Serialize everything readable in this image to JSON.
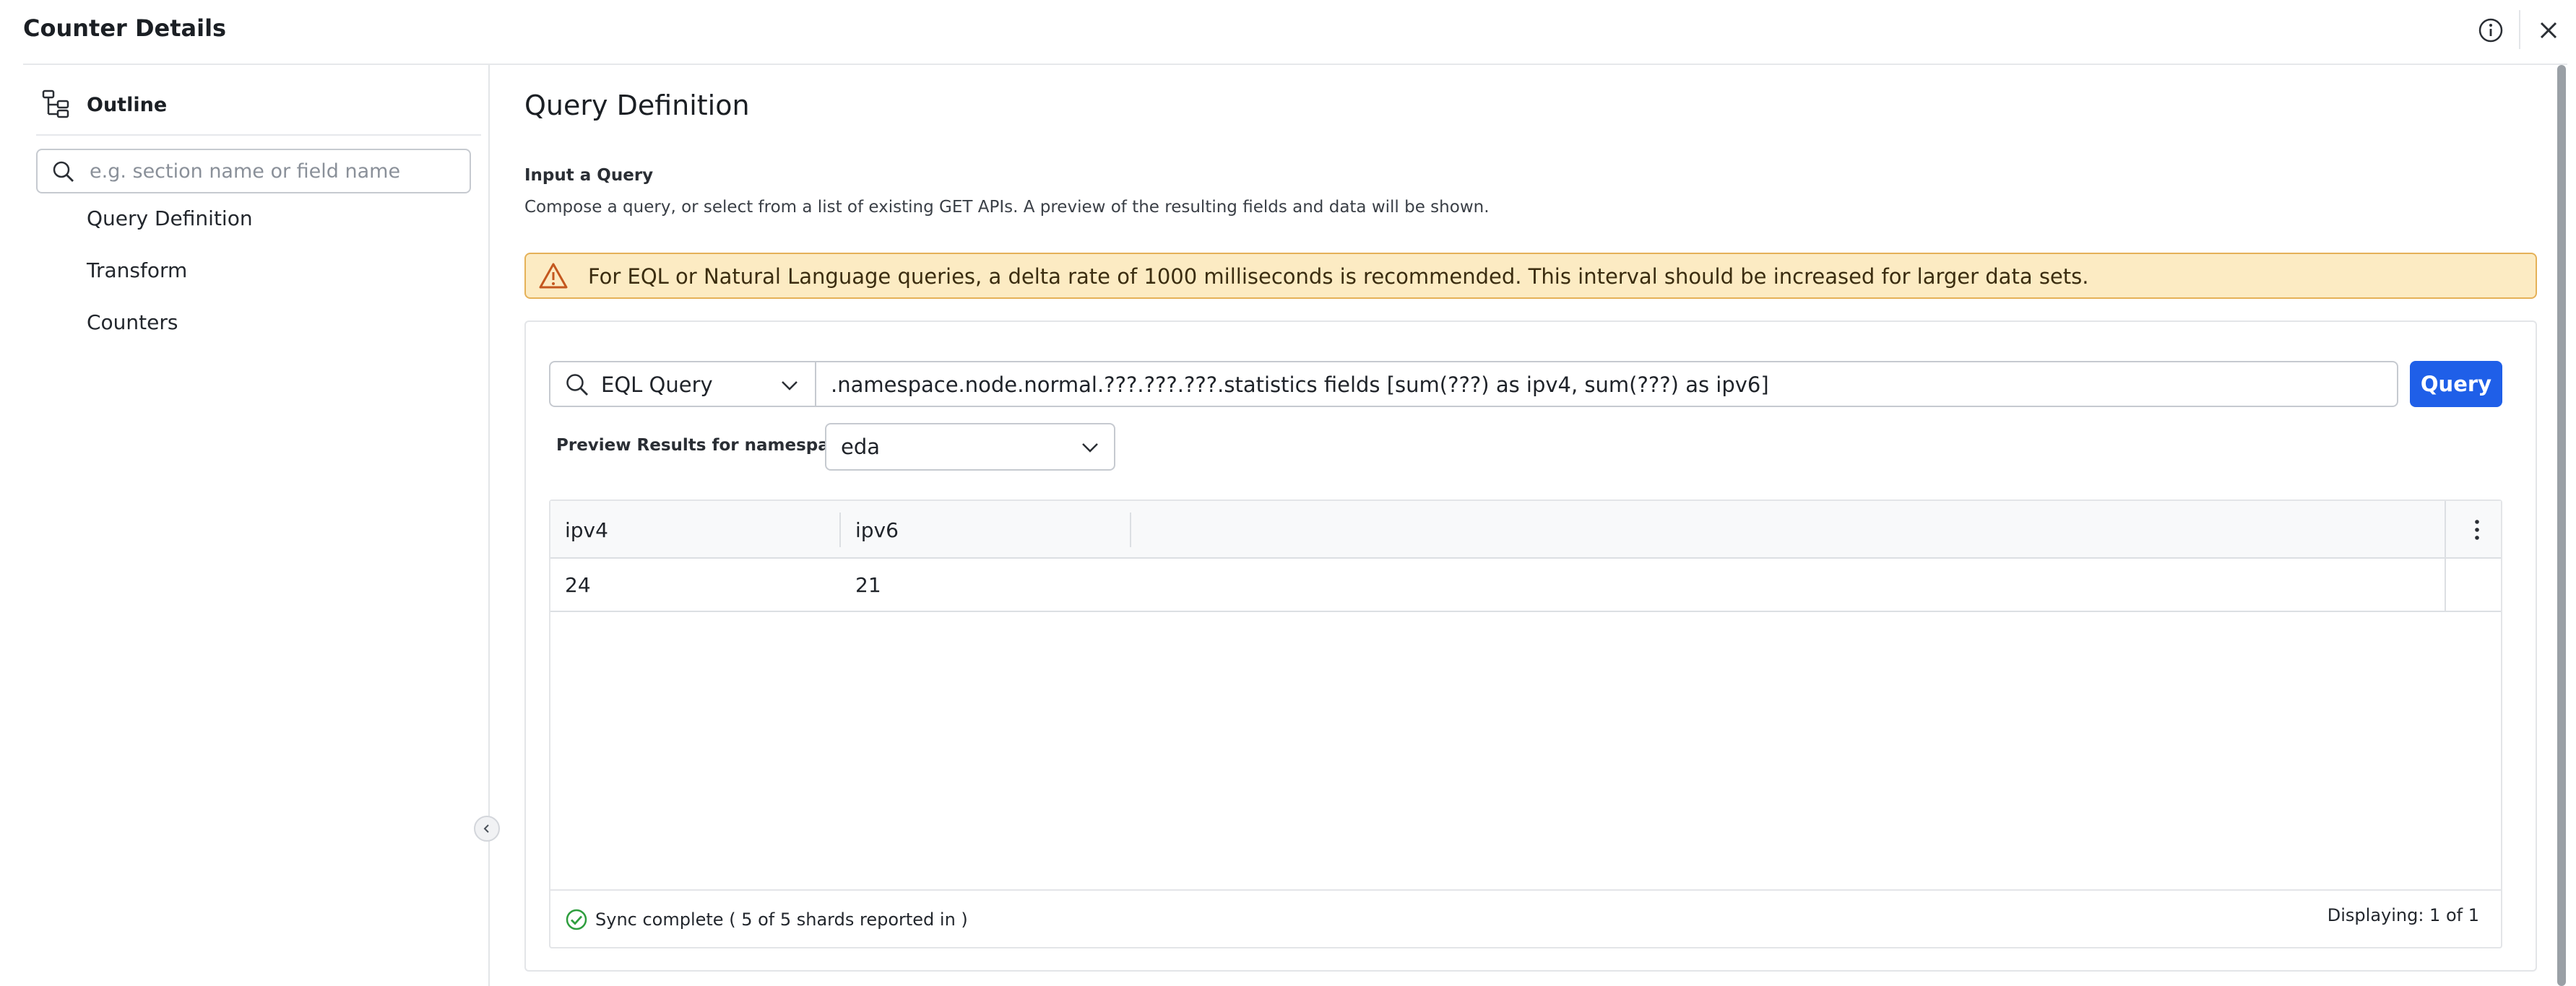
{
  "header": {
    "title": "Counter Details",
    "icons": {
      "info": "info-icon",
      "close": "close-icon"
    }
  },
  "sidebar": {
    "outline_label": "Outline",
    "outline_icon": "outline-tree-icon",
    "search_placeholder": "e.g. section name or field name",
    "items": [
      {
        "label": "Query Definition"
      },
      {
        "label": "Transform"
      },
      {
        "label": "Counters"
      }
    ]
  },
  "main": {
    "page_title": "Query Definition",
    "section_label": "Input a Query",
    "section_desc": "Compose a query, or select from a list of existing GET APIs. A preview of the resulting fields and data will be shown.",
    "warning": {
      "text": "For EQL or Natural Language queries, a delta rate of 1000 milliseconds is recommended. This interval should be increased for larger data sets.",
      "color": "#fcebc3",
      "border_color": "#e5b158"
    },
    "query": {
      "type": "EQL Query",
      "value": ".namespace.node.normal.???.???.???.statistics fields [sum(???) as ipv4, sum(???) as ipv6]",
      "button_label": "Query",
      "button_color": "#1f5fe8"
    },
    "namespace": {
      "label": "Preview Results for namespace",
      "value": "eda"
    },
    "table": {
      "columns": [
        "ipv4",
        "ipv6"
      ],
      "rows": [
        [
          "24",
          "21"
        ]
      ],
      "sync_status": "Sync complete ( 5 of 5 shards reported in )",
      "display_count": "Displaying: 1 of 1",
      "status_color": "#2e9e3e"
    }
  }
}
